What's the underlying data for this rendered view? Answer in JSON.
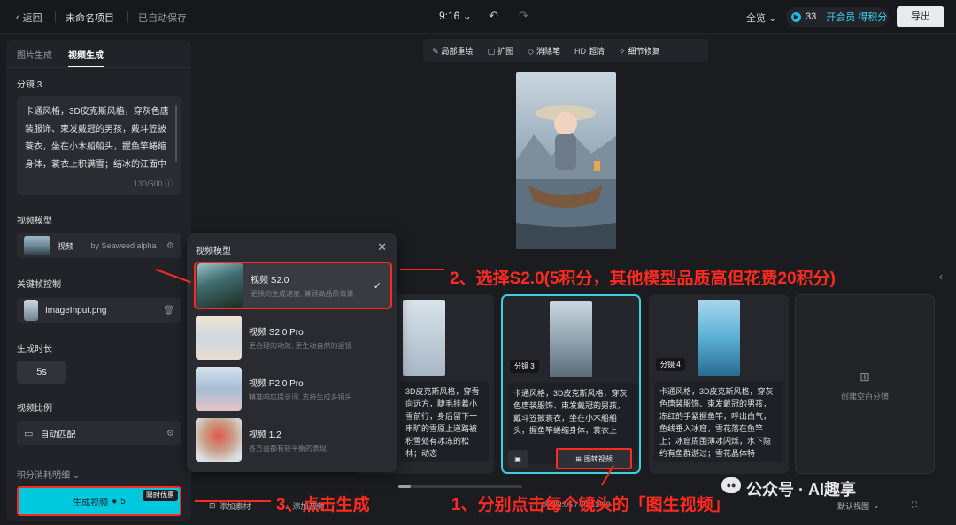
{
  "topbar": {
    "back_label": "返回",
    "project_name": "未命名项目",
    "save_status": "已自动保存",
    "time": "9:16",
    "zoom": "全览",
    "credits": "33",
    "vip_label": "开会员 得积分",
    "export_label": "导出"
  },
  "left": {
    "tabs": [
      "图片生成",
      "视频生成"
    ],
    "shot_label": "分镜 3",
    "prompt": "卡通风格，3D皮克斯风格，穿灰色唐装服饰、束发戴冠的男孩，戴斗笠披蓑衣，坐在小木船船头，握鱼竿蜷缩身体，蓑衣上积满雪；结冰的江面中",
    "prompt_count": "130/500",
    "model_label": "视频模型",
    "model_value": "视频 ···",
    "model_by": "by Seaweed alpha",
    "keyframe_label": "关键帧控制",
    "keyframe_file": "ImageInput.png",
    "duration_label": "生成时长",
    "duration_value": "5s",
    "ratio_label": "视频比例",
    "ratio_value": "自动匹配",
    "credit_detail": "积分消耗明细",
    "generate_label": "生成视频",
    "generate_cost": "5",
    "promo_badge": "限时优惠"
  },
  "popup": {
    "title": "视频模型",
    "models": [
      {
        "name": "视频 S2.0",
        "desc": "更快的生成速度, 兼顾高品质效果",
        "selected": true
      },
      {
        "name": "视频 S2.0 Pro",
        "desc": "更合理的动效, 更生动自然的运镜",
        "selected": false
      },
      {
        "name": "视频 P2.0 Pro",
        "desc": "精准响应提示词, 支持生成多镜头",
        "selected": false
      },
      {
        "name": "视频 1.2",
        "desc": "各方面都有较平衡的表现",
        "selected": false
      }
    ]
  },
  "toolbar": {
    "items": [
      "局部重绘",
      "扩图",
      "消除笔",
      "超清",
      "细节修复"
    ],
    "hd_prefix": "HD"
  },
  "cards": [
    {
      "shot": "",
      "text": "3D皮克斯风格，穿看向远方，睫毛挂着小雪前行，身后留下一串旷的雪原上道路被积雪处有冰冻的松林；动态"
    },
    {
      "shot": "分镜 3",
      "text": "卡通风格，3D皮克斯风格，穿灰色唐装服饰、束发戴冠的男孩，戴斗笠披蓑衣，坐在小木船船头，握鱼竿蜷缩身体，蓑衣上",
      "button": "图转视频"
    },
    {
      "shot": "分镜 4",
      "text": "卡通风格，3D皮克斯风格，穿灰色唐装服饰、束发戴冠的男孩，冻红的手紧握鱼竿，呼出白气，鱼线垂入冰窟，雪花落在鱼竿上；冰窟周围薄冰闪烁，水下隐约有鱼群游过；雪花晶体特"
    },
    {
      "empty_label": "创建空白分镜"
    }
  ],
  "bottom": {
    "add_material": "添加素材",
    "add_audio": "添加音频",
    "timecode": "00:03:05 / 00:13:00",
    "view": "默认视图"
  },
  "annotations": {
    "step1": "1、分别点击每个镜头的「图生视频」",
    "step2": "2、选择S2.0(5积分，其他模型品质高但花费20积分)",
    "step3": "3、点击生成"
  },
  "watermark": "公众号 · AI趣享"
}
